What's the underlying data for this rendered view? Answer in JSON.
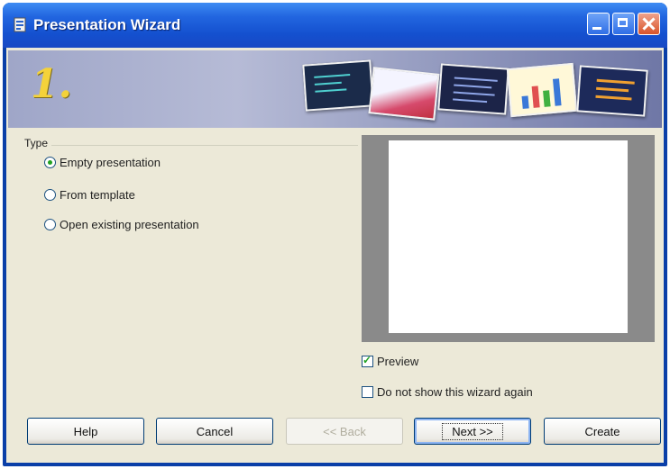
{
  "window": {
    "title": "Presentation Wizard"
  },
  "banner": {
    "step": "1."
  },
  "type_group": {
    "label": "Type",
    "options": [
      {
        "label": "Empty presentation",
        "selected": true
      },
      {
        "label": "From template",
        "selected": false
      },
      {
        "label": "Open existing presentation",
        "selected": false
      }
    ]
  },
  "preview": {
    "checkbox_label": "Preview",
    "checked": true
  },
  "dont_show": {
    "label": "Do not show this wizard again",
    "checked": false
  },
  "buttons": {
    "help": "Help",
    "cancel": "Cancel",
    "back": "<< Back",
    "next": "Next >>",
    "create": "Create"
  },
  "colors": {
    "titlebar": "#2266e0",
    "dialog_bg": "#ece9d8",
    "step_number": "#f4d23a"
  }
}
